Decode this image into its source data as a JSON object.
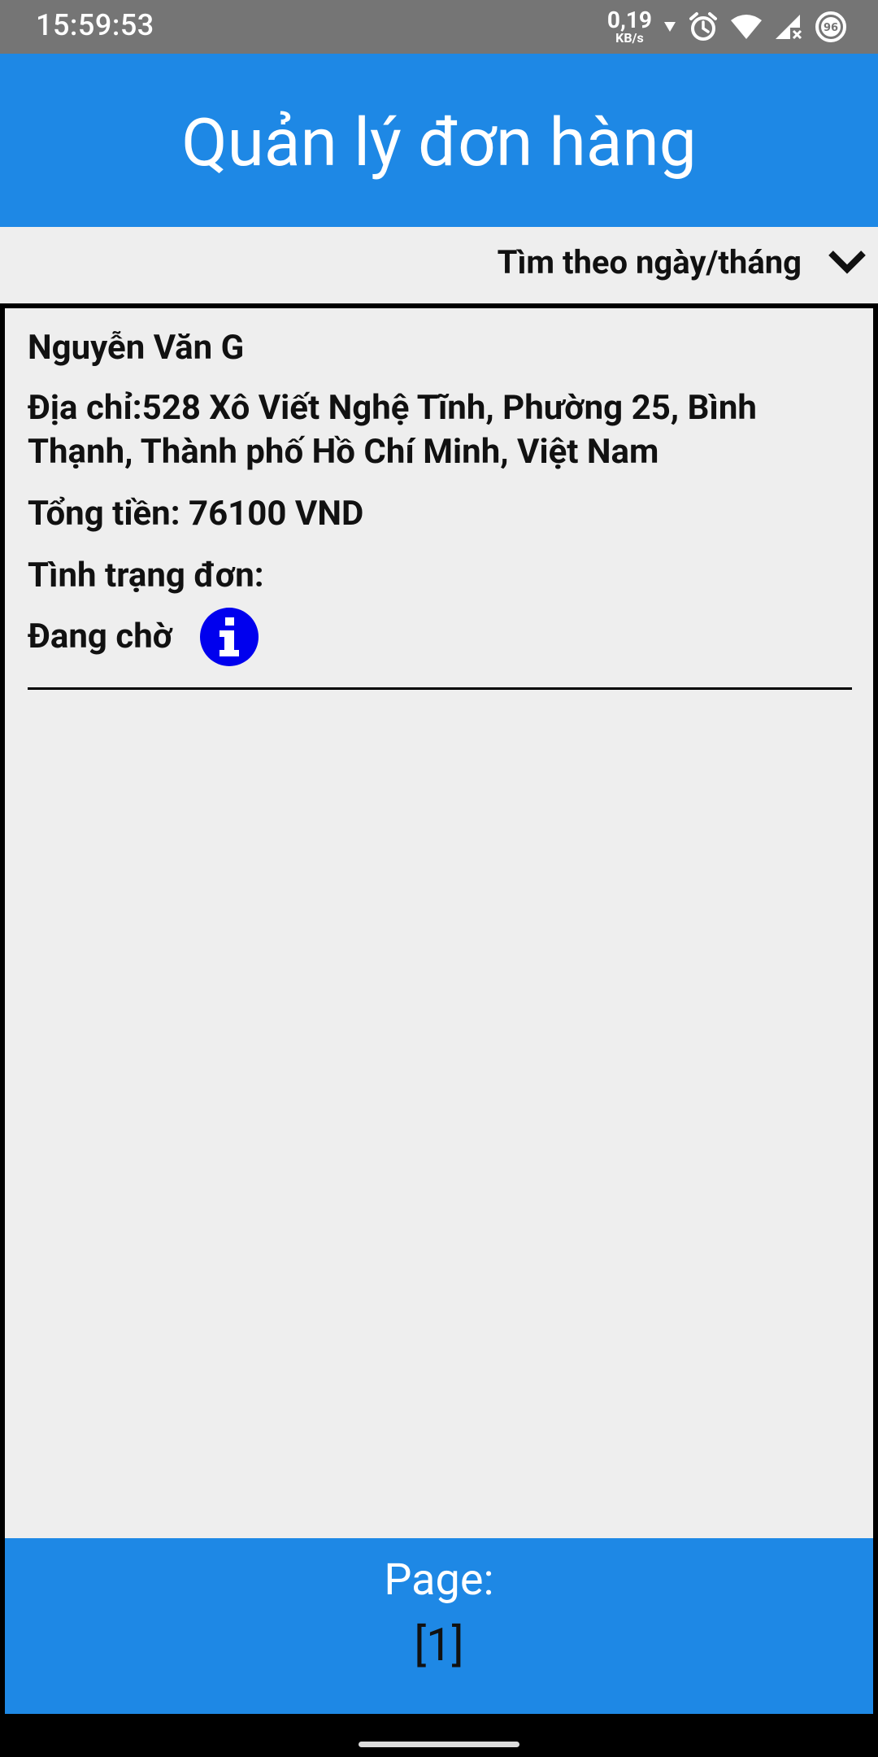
{
  "status_bar": {
    "time": "15:59:53",
    "net_speed_value": "0,19",
    "net_speed_unit": "KB/s",
    "battery_level": "96",
    "icons": [
      "data-down-arrow-icon",
      "alarm-icon",
      "wifi-icon",
      "signal-no-data-icon",
      "battery-icon"
    ]
  },
  "app_bar": {
    "title": "Quản lý đơn hàng"
  },
  "filter": {
    "label": "Tìm theo ngày/tháng",
    "icon": "chevron-down-icon"
  },
  "orders": [
    {
      "customer_name": "Nguyễn Văn G",
      "address": "Địa chỉ:528 Xô Viết Nghệ Tĩnh, Phường 25, Bình Thạnh, Thành phố Hồ Chí Minh, Việt Nam",
      "total": "Tổng tiền: 76100 VND",
      "status_label": "Tình trạng đơn:",
      "status_value": "Đang chờ",
      "info_icon": "info-icon",
      "info_icon_color": "#0000ee"
    }
  ],
  "pagination": {
    "label": "Page:",
    "current": "[1]"
  },
  "colors": {
    "primary": "#1e88e5",
    "status_bar": "#757575",
    "background": "#eeeeee"
  }
}
